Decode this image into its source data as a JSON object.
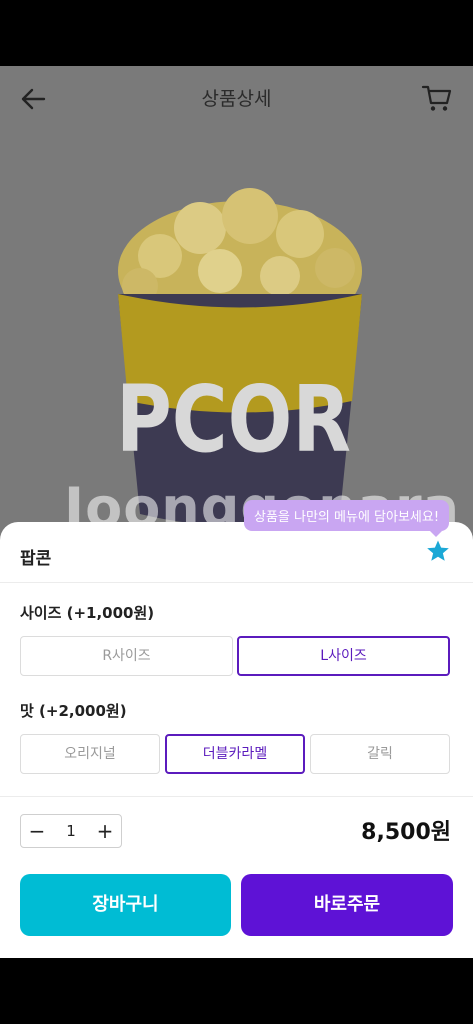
{
  "header": {
    "title": "상품상세",
    "back_icon": "back-arrow-icon",
    "cart_icon": "cart-icon"
  },
  "watermark": "Joonggonara",
  "product": {
    "name": "팝콘",
    "cup_text": "PCOR",
    "favorite_tooltip": "상품을 나만의 메뉴에 담아보세요!",
    "favorite_icon": "star-icon"
  },
  "options": {
    "size_label": "사이즈 (+1,000원)",
    "sizes": [
      "R사이즈",
      "L사이즈"
    ],
    "flavor_label": "맛 (+2,000원)",
    "flavors": [
      "오리지널",
      "더블카라멜",
      "갈릭"
    ]
  },
  "quantity": {
    "value": "1",
    "minus": "−",
    "plus": "+"
  },
  "price": "8,500원",
  "actions": {
    "cart": "장바구니",
    "buy": "바로주문"
  },
  "colors": {
    "accent_purple": "#5e12d6",
    "accent_cyan": "#00bcd4",
    "tooltip": "#c9a6f2",
    "star": "#1ba8d6"
  }
}
